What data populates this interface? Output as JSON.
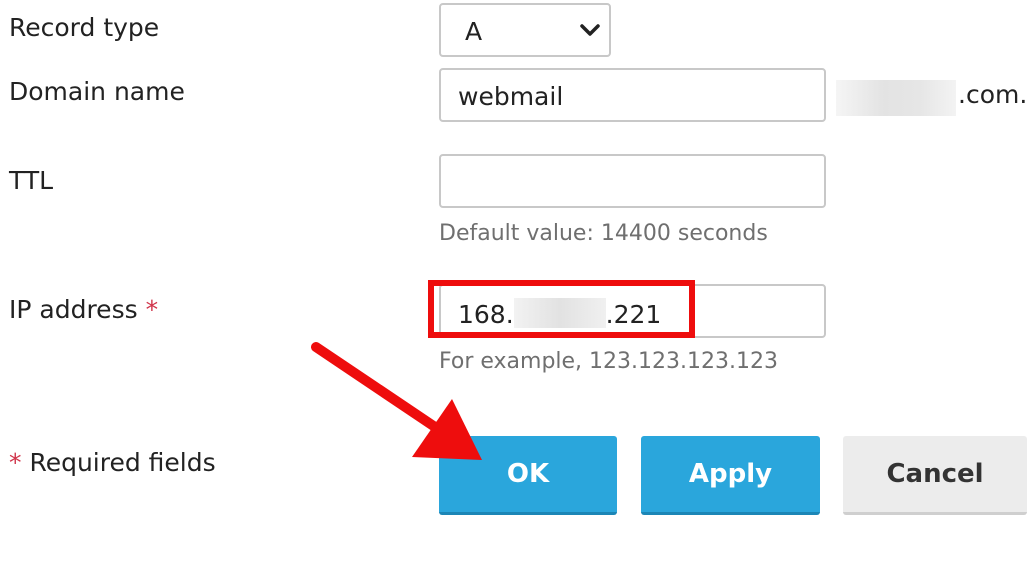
{
  "form": {
    "record_type": {
      "label": "Record type",
      "value": "A"
    },
    "domain_name": {
      "label": "Domain name",
      "value": "webmail",
      "suffix": ".com."
    },
    "ttl": {
      "label": "TTL",
      "value": "",
      "hint": "Default value: 14400 seconds"
    },
    "ip_address": {
      "label": "IP address",
      "required_mark": "*",
      "value_prefix": "168.",
      "value_suffix": ".221",
      "hint": "For example, 123.123.123.123"
    },
    "required_note": {
      "mark": "*",
      "text": "Required fields"
    }
  },
  "buttons": {
    "ok": "OK",
    "apply": "Apply",
    "cancel": "Cancel"
  },
  "colors": {
    "primary_button": "#2aa6dc",
    "secondary_button": "#ececec",
    "highlight": "#ee0d0d",
    "required_star": "#d0344a"
  },
  "icons": {
    "select_chevron": "chevron-down-icon",
    "annotation": "arrow-annotation"
  }
}
